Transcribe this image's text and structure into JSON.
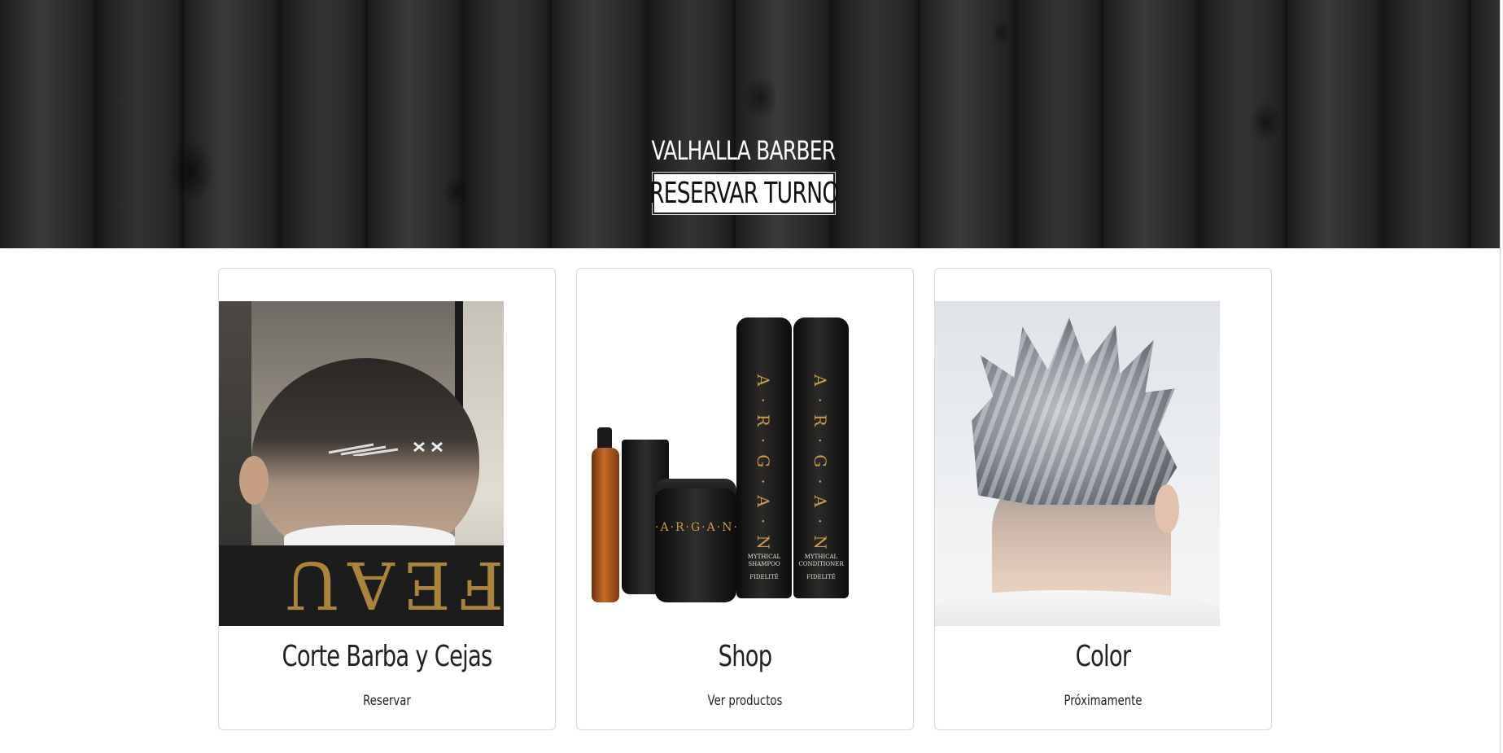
{
  "hero": {
    "brand": "VALHALLA BARBER",
    "cta_label": "RESERVAR TURNO"
  },
  "cards": [
    {
      "title": "Corte Barba y Cejas",
      "link": "Reservar",
      "image": "haircut-photo"
    },
    {
      "title": "Shop",
      "link": "Ver productos",
      "image": "argan-products-photo",
      "image_text": {
        "brand": "A·R·G·A·N",
        "jar_label": "·A·R·G·A·N·",
        "shampoo": "MYTHICAL SHAMPOO",
        "conditioner": "MYTHICAL CONDITIONER",
        "maker": "FIDELITÉ"
      }
    },
    {
      "title": "Color",
      "link": "Próximamente",
      "image": "gray-hair-color-photo"
    }
  ],
  "colors": {
    "hero_wood": "#2a2a2a",
    "text": "#222222",
    "card_border": "#d9d9d9",
    "argan_gold": "#c89a4a"
  }
}
